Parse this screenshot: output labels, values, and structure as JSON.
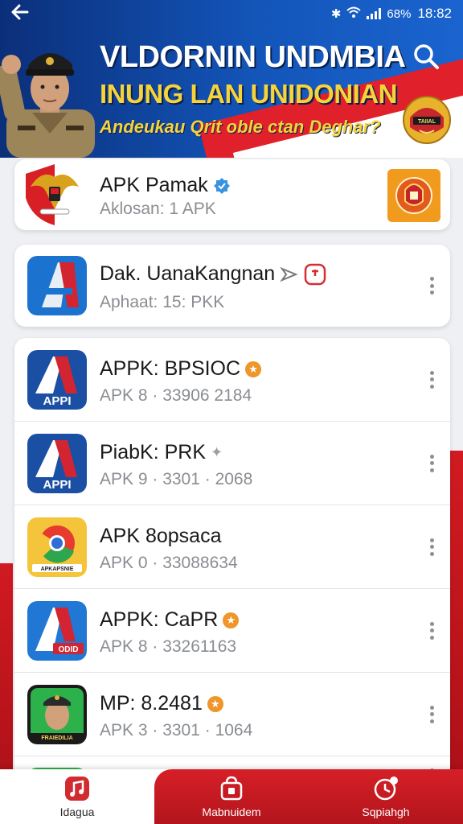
{
  "status_bar": {
    "battery": "68%",
    "time": "18:82"
  },
  "header": {
    "line1": "VLDORNIN UNDMBIA",
    "line2": "INUNG LAN UNIDONIAN",
    "line3": "Andeukau Qrit oble ctan Deghar?",
    "emblem_text": "TAIIAL",
    "colors": {
      "banner_blue": "#1355b9",
      "accent_yellow": "#f7d33a",
      "flag_red": "#e0202a"
    }
  },
  "featured": {
    "title": "APK Pamak",
    "subtitle": "Aklosan: 1 APK",
    "icon": "garuda-emblem-icon",
    "side_icon": "police-emblem-icon"
  },
  "second": {
    "title": "Dak. UanaKangnan",
    "subtitle": "Aphaat: 15: PKK",
    "icon": "apk-a-icon"
  },
  "apps": [
    {
      "title": "APPK: BPSIOC",
      "subtitle": "APK 8 · 33906 2184",
      "icon_text": "APPI",
      "icon": "apk-a-icon",
      "badge_color": "#f0952a"
    },
    {
      "title": "PiabK: PRK",
      "subtitle": "APK 9 · 3301 · 2068",
      "icon_text": "APPI",
      "icon": "apk-a-icon",
      "badge_color": "#9aa0a6"
    },
    {
      "title": "APK 8opsaca",
      "subtitle": "APK 0 · 33088634",
      "icon_text": "APKAPSNIE",
      "icon": "chrome-style-icon",
      "badge_color": ""
    },
    {
      "title": "APPK: CaPR",
      "subtitle": "APK 8 · 33261163",
      "icon_text": "ODID",
      "icon": "apk-a-icon",
      "badge_color": "#f0952a"
    },
    {
      "title": "MP: 8.2481",
      "subtitle": "APK 3 · 3301 · 1064",
      "icon_text": "FRAIEDILIA",
      "icon": "officer-portrait-icon",
      "badge_color": "#f0952a"
    }
  ],
  "nav": [
    {
      "label": "Idagua",
      "icon": "music-app-icon"
    },
    {
      "label": "Mabnuidem",
      "icon": "bag-icon"
    },
    {
      "label": "Sqpiahgh",
      "icon": "clock-icon"
    }
  ]
}
